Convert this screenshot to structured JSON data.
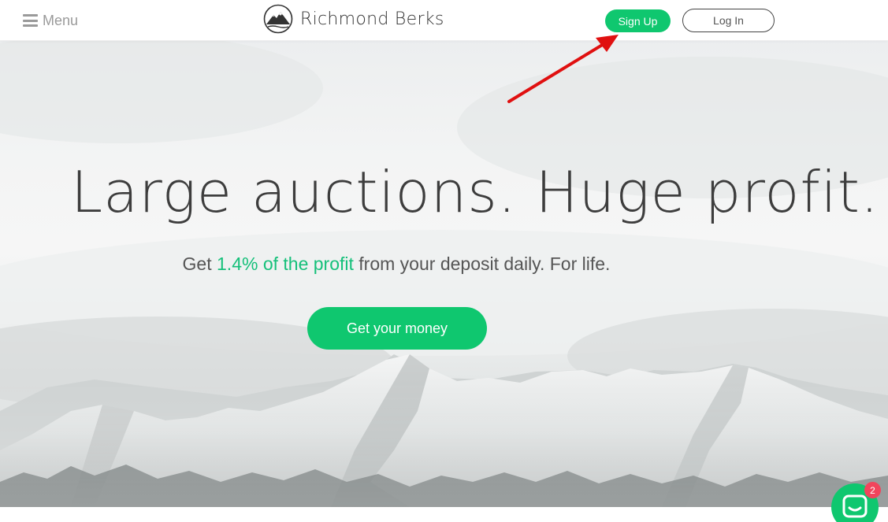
{
  "header": {
    "menu_label": "Menu",
    "brand_name": "Richmond Berks",
    "signup_label": "Sign Up",
    "login_label": "Log In"
  },
  "hero": {
    "headline": "Large auctions. Huge profit.",
    "subline_prefix": "Get ",
    "subline_highlight": "1.4% of the profit",
    "subline_suffix": " from your deposit daily. For life.",
    "cta_label": "Get your money"
  },
  "chat": {
    "badge_count": "2"
  },
  "icons": {
    "menu": "hamburger-icon",
    "logo": "mountain-logo-icon",
    "chat": "chat-bubble-icon",
    "annotation": "red-arrow"
  },
  "colors": {
    "accent_green": "#0fc76f",
    "badge_red": "#f2445c",
    "annotation_red": "#e01010",
    "text_dark": "#3d3d3d"
  }
}
